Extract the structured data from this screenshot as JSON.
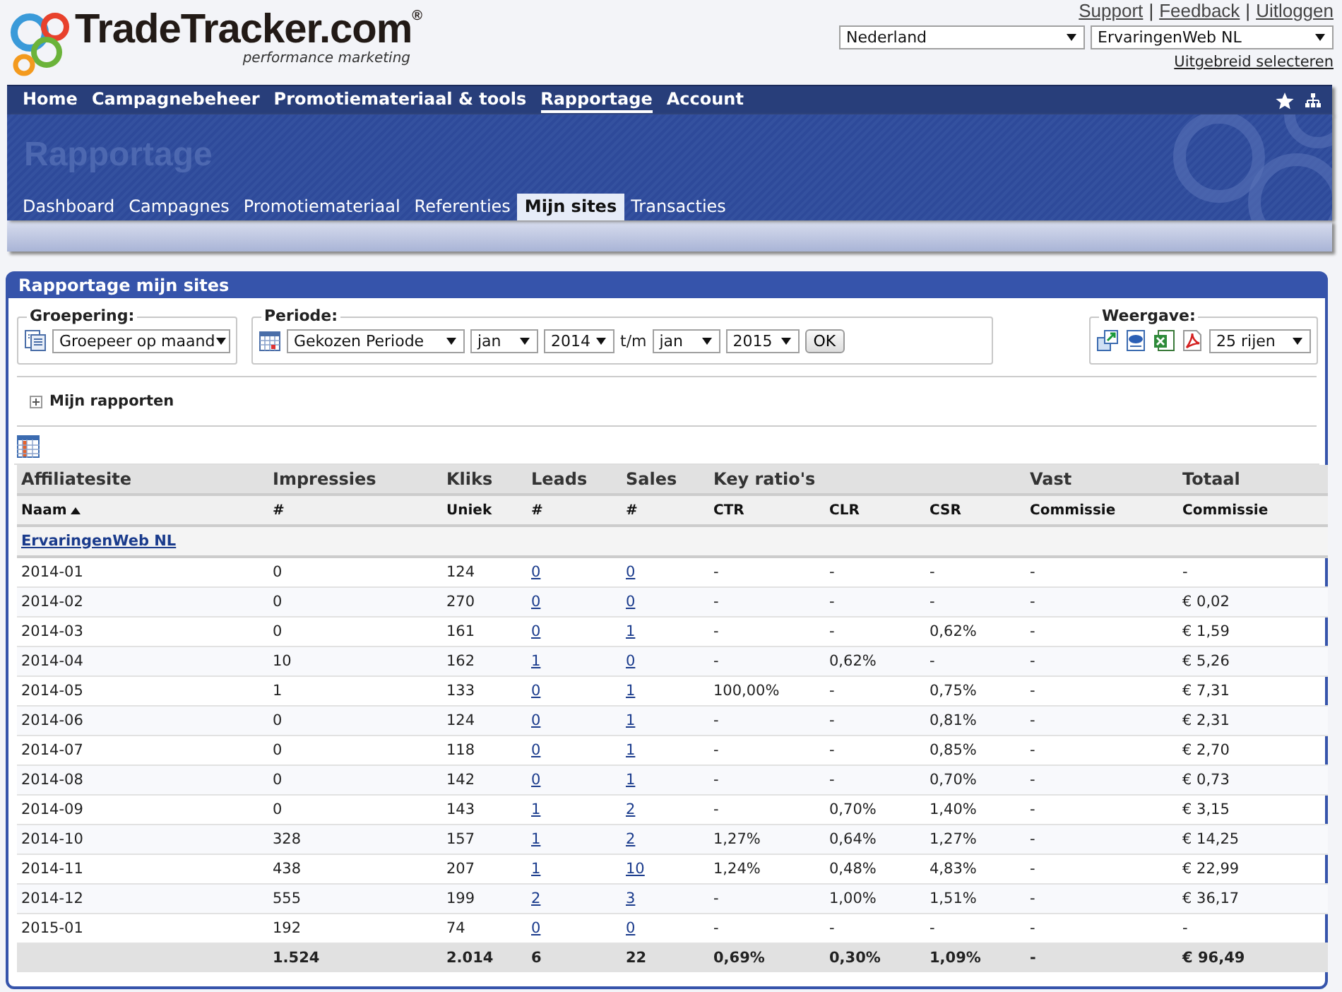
{
  "header": {
    "logo": {
      "name": "TradeTracker.com",
      "mark": "®",
      "tagline": "performance marketing"
    },
    "top_links": [
      {
        "kind": "link",
        "text": "Support"
      },
      {
        "kind": "separator",
        "text": "|"
      },
      {
        "kind": "link",
        "text": "Feedback"
      },
      {
        "kind": "separator",
        "text": "|"
      },
      {
        "kind": "link",
        "text": "Uitloggen"
      }
    ],
    "selects": [
      {
        "value": "Nederland"
      },
      {
        "value": "ErvaringenWeb NL"
      }
    ],
    "advanced_link": "Uitgebreid selecteren"
  },
  "main_nav": [
    {
      "label": "Home",
      "selected": false
    },
    {
      "label": "Campagnebeheer",
      "selected": false
    },
    {
      "label": "Promotiemateriaal & tools",
      "selected": false
    },
    {
      "label": "Rapportage",
      "selected": true
    },
    {
      "label": "Account",
      "selected": false
    }
  ],
  "banner_title": "Rapportage",
  "sub_tabs": [
    {
      "label": "Dashboard",
      "selected": false
    },
    {
      "label": "Campagnes",
      "selected": false
    },
    {
      "label": "Promotiemateriaal",
      "selected": false
    },
    {
      "label": "Referenties",
      "selected": false
    },
    {
      "label": "Mijn sites",
      "selected": true
    },
    {
      "label": "Transacties",
      "selected": false
    }
  ],
  "panel": {
    "title": "Rapportage mijn sites",
    "groupering": {
      "legend": "Groepering:",
      "value": "Groepeer op maand"
    },
    "periode": {
      "legend": "Periode:",
      "period": "Gekozen Periode",
      "from_month": "jan",
      "from_year": "2014",
      "separator": "t/m",
      "to_month": "jan",
      "to_year": "2015",
      "button": "OK"
    },
    "weergave": {
      "legend": "Weergave:",
      "rows": "25 rijen"
    },
    "my_reports": "Mijn rapporten",
    "table": {
      "header_groups": [
        {
          "label": "Affiliatesite",
          "columns": [
            {
              "label": "Naam",
              "sorted_ascending": true,
              "kind": "text"
            }
          ]
        },
        {
          "label": "Impressies",
          "columns": [
            {
              "label": "#",
              "kind": "text"
            }
          ]
        },
        {
          "label": "Kliks",
          "columns": [
            {
              "label": "Uniek",
              "kind": "text"
            }
          ]
        },
        {
          "label": "Leads",
          "columns": [
            {
              "label": "#",
              "kind": "link"
            }
          ]
        },
        {
          "label": "Sales",
          "columns": [
            {
              "label": "#",
              "kind": "link"
            }
          ]
        },
        {
          "label": "Key ratio's",
          "columns": [
            {
              "label": "CTR",
              "kind": "text"
            },
            {
              "label": "CLR",
              "kind": "text"
            },
            {
              "label": "CSR",
              "kind": "text"
            }
          ]
        },
        {
          "label": "Vast",
          "columns": [
            {
              "label": "Commissie",
              "kind": "text"
            }
          ]
        },
        {
          "label": "Totaal",
          "columns": [
            {
              "label": "Commissie",
              "kind": "text"
            }
          ]
        }
      ],
      "group_row": "ErvaringenWeb NL",
      "rows": [
        [
          "2014-01",
          "0",
          "124",
          "0",
          "0",
          "-",
          "-",
          "-",
          "-",
          "-"
        ],
        [
          "2014-02",
          "0",
          "270",
          "0",
          "0",
          "-",
          "-",
          "-",
          "-",
          "€ 0,02"
        ],
        [
          "2014-03",
          "0",
          "161",
          "0",
          "1",
          "-",
          "-",
          "0,62%",
          "-",
          "€ 1,59"
        ],
        [
          "2014-04",
          "10",
          "162",
          "1",
          "0",
          "-",
          "0,62%",
          "-",
          "-",
          "€ 5,26"
        ],
        [
          "2014-05",
          "1",
          "133",
          "0",
          "1",
          "100,00%",
          "-",
          "0,75%",
          "-",
          "€ 7,31"
        ],
        [
          "2014-06",
          "0",
          "124",
          "0",
          "1",
          "-",
          "-",
          "0,81%",
          "-",
          "€ 2,31"
        ],
        [
          "2014-07",
          "0",
          "118",
          "0",
          "1",
          "-",
          "-",
          "0,85%",
          "-",
          "€ 2,70"
        ],
        [
          "2014-08",
          "0",
          "142",
          "0",
          "1",
          "-",
          "-",
          "0,70%",
          "-",
          "€ 0,73"
        ],
        [
          "2014-09",
          "0",
          "143",
          "1",
          "2",
          "-",
          "0,70%",
          "1,40%",
          "-",
          "€ 3,15"
        ],
        [
          "2014-10",
          "328",
          "157",
          "1",
          "2",
          "1,27%",
          "0,64%",
          "1,27%",
          "-",
          "€ 14,25"
        ],
        [
          "2014-11",
          "438",
          "207",
          "1",
          "10",
          "1,24%",
          "0,48%",
          "4,83%",
          "-",
          "€ 22,99"
        ],
        [
          "2014-12",
          "555",
          "199",
          "2",
          "3",
          "-",
          "1,00%",
          "1,51%",
          "-",
          "€ 36,17"
        ],
        [
          "2015-01",
          "192",
          "74",
          "0",
          "0",
          "-",
          "-",
          "-",
          "-",
          "-"
        ]
      ],
      "totals": [
        "1.524",
        "2.014",
        "6",
        "22",
        "0,69%",
        "0,30%",
        "1,09%",
        "-",
        "€ 96,49"
      ]
    }
  }
}
